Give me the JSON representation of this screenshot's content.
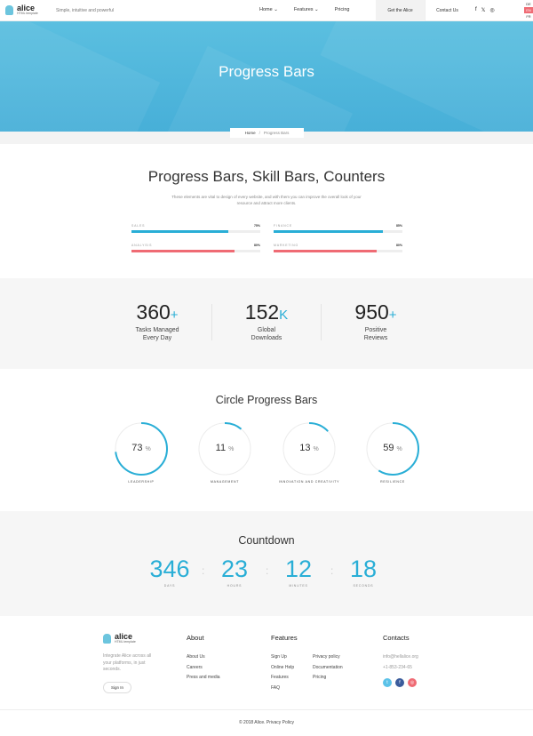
{
  "header": {
    "brand": "alice",
    "brand_sub": "HTML template",
    "tagline": "Simple, intuitive and powerful",
    "nav": [
      {
        "label": "Home ⌄"
      },
      {
        "label": "Features ⌄"
      },
      {
        "label": "Pricing"
      }
    ],
    "get_button": "Get the Alice",
    "contact_button": "Contact Us",
    "social_icons": [
      "facebook-icon",
      "twitter-icon",
      "instagram-icon"
    ],
    "social_glyphs": [
      "f",
      "𝕏",
      "◎"
    ],
    "languages": [
      "DE",
      "EN",
      "FR"
    ],
    "active_language": "EN"
  },
  "hero": {
    "title": "Progress Bars",
    "breadcrumb_home": "Home",
    "breadcrumb_sep": "/",
    "breadcrumb_current": "Progress Bars"
  },
  "section1": {
    "title": "Progress Bars, Skill Bars, Counters",
    "description": "These elements are vital to design of every website, and with them you can improve the overall look of your resource and attract more clients.",
    "bars": [
      {
        "label": "SALES",
        "value": "75%",
        "percent": 75,
        "color": "#29aed6"
      },
      {
        "label": "FINANCE",
        "value": "85%",
        "percent": 85,
        "color": "#29aed6"
      },
      {
        "label": "ANALYSIS",
        "value": "80%",
        "percent": 80,
        "color": "#ef6b74"
      },
      {
        "label": "MARKETING",
        "value": "80%",
        "percent": 80,
        "color": "#ef6b74"
      }
    ]
  },
  "counters": [
    {
      "number": "360",
      "suffix": "+",
      "label": "Tasks Managed Every Day"
    },
    {
      "number": "152",
      "suffix": "K",
      "label": "Global Downloads"
    },
    {
      "number": "950",
      "suffix": "+",
      "label": "Positive Reviews"
    }
  ],
  "circles": {
    "title": "Circle Progress Bars",
    "items": [
      {
        "value": "73",
        "unit": "%",
        "percent": 73,
        "label": "LEADERSHIP"
      },
      {
        "value": "11",
        "unit": "%",
        "percent": 11,
        "label": "MANAGEMENT"
      },
      {
        "value": "13",
        "unit": "%",
        "percent": 13,
        "label": "INNOVATION AND CREATIVITY"
      },
      {
        "value": "59",
        "unit": "%",
        "percent": 59,
        "label": "RESILIENCE"
      }
    ]
  },
  "countdown": {
    "title": "Countdown",
    "separator": ":",
    "units": [
      {
        "value": "346",
        "label": "DAYS"
      },
      {
        "value": "23",
        "label": "HOURS"
      },
      {
        "value": "12",
        "label": "MINUTES"
      },
      {
        "value": "18",
        "label": "SECONDS"
      }
    ]
  },
  "footer": {
    "brand": "alice",
    "brand_sub": "HTML template",
    "about_text": "Integrate Alice across all your platforms, in just seconds.",
    "signin": "Sign In",
    "about_title": "About",
    "about_links": [
      "About Us",
      "Careers",
      "Press and media"
    ],
    "features_title": "Features",
    "features_col1": [
      "Sign Up",
      "Online Help",
      "Features",
      "FAQ"
    ],
    "features_col2": [
      "Privacy policy",
      "Documentation",
      "Pricing"
    ],
    "contacts_title": "Contacts",
    "email": "info@hellalice.org",
    "phone": "+1-853-234-65",
    "social": [
      {
        "icon": "twitter-icon",
        "glyph": "t",
        "color": "#5bc2e8"
      },
      {
        "icon": "facebook-icon",
        "glyph": "f",
        "color": "#3b5c9c"
      },
      {
        "icon": "instagram-icon",
        "glyph": "◎",
        "color": "#ef6b74"
      }
    ],
    "copyright": "© 2018 Alice. Privacy Policy"
  },
  "colors": {
    "accent": "#29aed6",
    "accent_red": "#ef6b74",
    "hero": "#4cb4db"
  }
}
